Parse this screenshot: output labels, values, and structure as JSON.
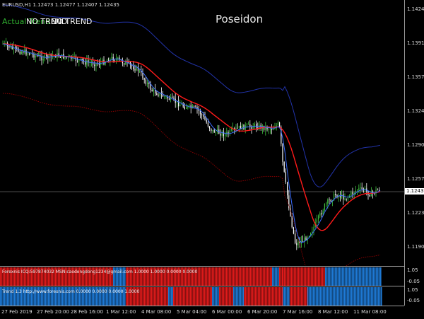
{
  "chart": {
    "symbol_line": "EURUSD,H1  1.12473 1.12477 1.12407 1.12435",
    "title": "Poseidon",
    "trend_labels": [
      {
        "text": "Actual Trend",
        "color": "#2fae2f"
      },
      {
        "text": "NO TREND",
        "color": "#ffffff"
      },
      {
        "text": "NO TREND",
        "color": "#ffffff"
      }
    ],
    "current_price": "1.12435",
    "price_ticks": [
      "1.14245",
      "1.13910",
      "1.13575",
      "1.13240",
      "1.12905",
      "1.12570",
      "1.12235",
      "1.11900"
    ],
    "colors": {
      "up_bar": "#3fc23f",
      "down_bar": "#ffffff",
      "ma_red": "#ff1a1a",
      "band_blue": "#2233aa",
      "band_lower": "#8b0000",
      "fast_blue": "#3a6cff"
    }
  },
  "indicator1": {
    "label": "Forexnis  ICQ:597874032  MSN:caodongdong1234@gmail.com  1.0000 1.0000 0.0000 0.0000",
    "scale_top": "1.05",
    "scale_bottom": "-0.05"
  },
  "indicator2": {
    "label": "Trend 1.3  http://www.forexnis.com    0.0000 0.0000 0.0000 1.0000",
    "scale_top": "1.05",
    "scale_bottom": "-0.05"
  },
  "time_axis": [
    "27 Feb 2019",
    "27 Feb 20:00",
    "28 Feb 16:00",
    "1 Mar 12:00",
    "4 Mar 08:00",
    "5 Mar 04:00",
    "6 Mar 00:00",
    "6 Mar 20:00",
    "7 Mar 16:00",
    "8 Mar 12:00",
    "11 Mar 08:00"
  ]
}
